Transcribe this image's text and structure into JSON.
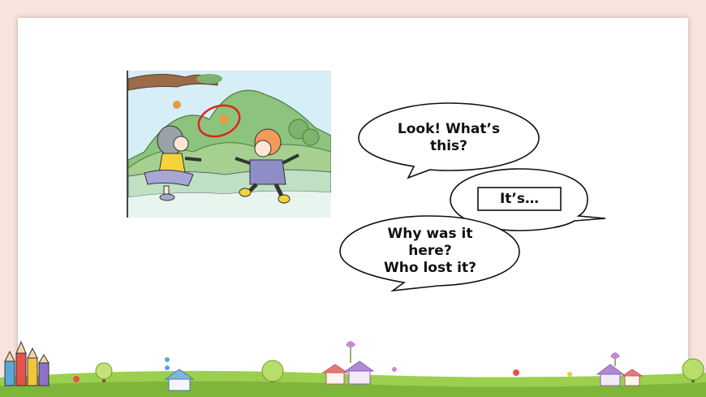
{
  "slide": {
    "bubble1": {
      "line1": "Look! What’s",
      "line2": "this?"
    },
    "bubble2": {
      "text": "It’s…"
    },
    "bubble3": {
      "line1": "Why was it",
      "line2": "here?",
      "line3": "Who lost it?"
    }
  },
  "colors": {
    "background": "#f7e4dc",
    "slide": "#ffffff",
    "grass": "#9ccf4e",
    "highlight_circle": "#e0241e"
  },
  "icons": [
    "illustration-kids-in-park",
    "pencil-icon",
    "tree-icon",
    "house-icon",
    "flower-icon"
  ]
}
